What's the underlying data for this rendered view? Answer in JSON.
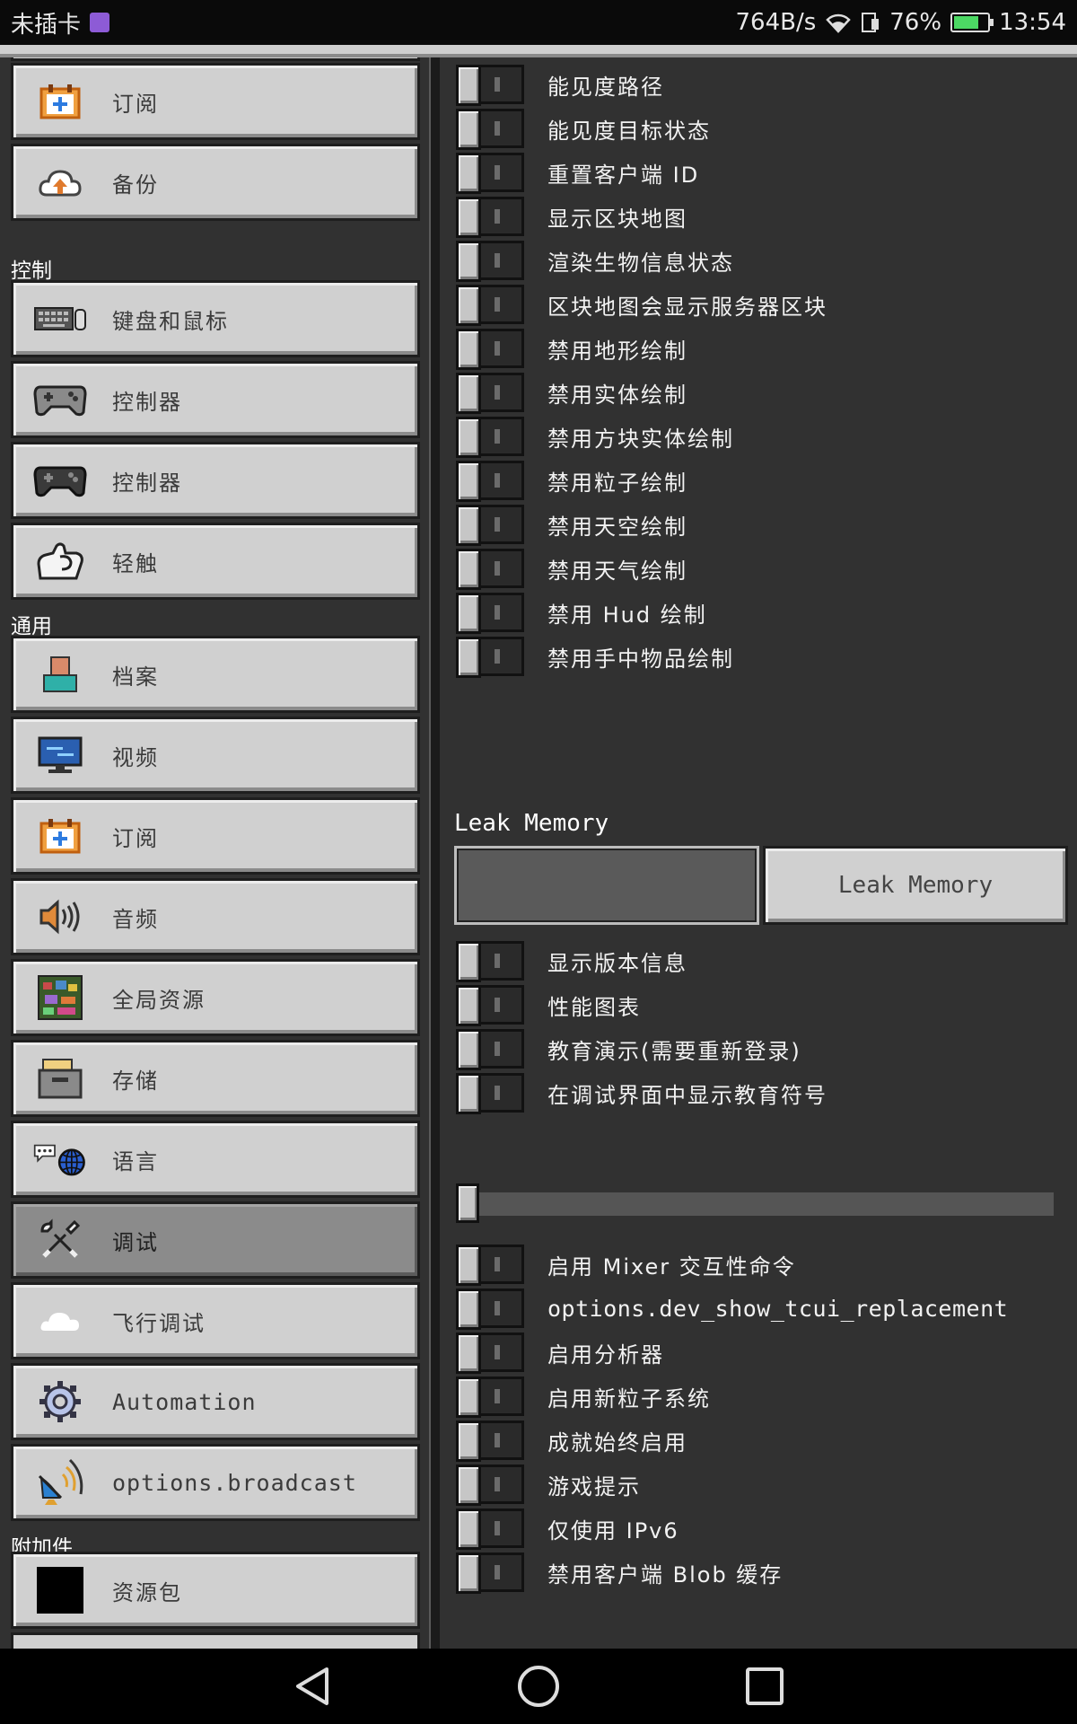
{
  "status": {
    "carrier": "未插卡",
    "speed": "764B/s",
    "battery_pct": "76%",
    "battery_level": 0.76,
    "time": "13:54"
  },
  "sidebar": {
    "sections": {
      "controls": "控制",
      "general": "通用",
      "addons": "附加件"
    },
    "items": [
      {
        "label": "订阅",
        "icon": "calendar-plus-icon"
      },
      {
        "label": "备份",
        "icon": "cloud-upload-icon"
      },
      {
        "label": "键盘和鼠标",
        "icon": "keyboard-mouse-icon"
      },
      {
        "label": "控制器",
        "icon": "gamepad-gray-icon"
      },
      {
        "label": "控制器",
        "icon": "gamepad-dark-icon"
      },
      {
        "label": "轻触",
        "icon": "touch-hand-icon"
      },
      {
        "label": "档案",
        "icon": "profile-icon"
      },
      {
        "label": "视频",
        "icon": "monitor-icon"
      },
      {
        "label": "订阅",
        "icon": "calendar-plus-icon"
      },
      {
        "label": "音频",
        "icon": "speaker-icon"
      },
      {
        "label": "全局资源",
        "icon": "global-resources-icon"
      },
      {
        "label": "存储",
        "icon": "storage-box-icon"
      },
      {
        "label": "语言",
        "icon": "language-globe-icon"
      },
      {
        "label": "调试",
        "icon": "wrench-tools-icon",
        "active": true
      },
      {
        "label": "飞行调试",
        "icon": "cloud-icon"
      },
      {
        "label": "Automation",
        "icon": "gear-icon"
      },
      {
        "label": "options.broadcast",
        "icon": "satellite-dish-icon"
      },
      {
        "label": "资源包",
        "icon": "resource-pack-icon"
      }
    ]
  },
  "toggles_top": [
    {
      "label": "能见度路径",
      "on": false
    },
    {
      "label": "能见度目标状态",
      "on": false
    },
    {
      "label": "重置客户端 ID",
      "on": false
    },
    {
      "label": "显示区块地图",
      "on": false
    },
    {
      "label": "渲染生物信息状态",
      "on": false
    },
    {
      "label": "区块地图会显示服务器区块",
      "on": false
    },
    {
      "label": "禁用地形绘制",
      "on": false
    },
    {
      "label": "禁用实体绘制",
      "on": false
    },
    {
      "label": "禁用方块实体绘制",
      "on": false
    },
    {
      "label": "禁用粒子绘制",
      "on": false
    },
    {
      "label": "禁用天空绘制",
      "on": false
    },
    {
      "label": "禁用天气绘制",
      "on": false
    },
    {
      "label": "禁用 Hud 绘制",
      "on": false
    },
    {
      "label": "禁用手中物品绘制",
      "on": false
    }
  ],
  "leak": {
    "title": "Leak Memory",
    "input_value": "",
    "button_label": "Leak Memory"
  },
  "toggles_mid": [
    {
      "label": "显示版本信息",
      "on": false
    },
    {
      "label": "性能图表",
      "on": false
    },
    {
      "label": "教育演示(需要重新登录)",
      "on": false
    },
    {
      "label": "在调试界面中显示教育符号",
      "on": false
    }
  ],
  "slider": {
    "value": 0
  },
  "toggles_bottom": [
    {
      "label": "启用 Mixer 交互性命令",
      "on": false
    },
    {
      "label": "options.dev_show_tcui_replacement",
      "on": false
    },
    {
      "label": "启用分析器",
      "on": false
    },
    {
      "label": "启用新粒子系统",
      "on": false
    },
    {
      "label": "成就始终启用",
      "on": false
    },
    {
      "label": "游戏提示",
      "on": false
    },
    {
      "label": "仅使用 IPv6",
      "on": false
    },
    {
      "label": "禁用客户端 Blob 缓存",
      "on": false
    }
  ]
}
